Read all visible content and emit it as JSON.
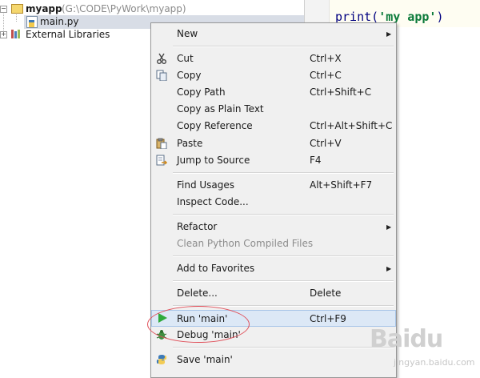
{
  "project_tree": {
    "root": {
      "name": "myapp",
      "path": "(G:\\CODE\\PyWork\\myapp)"
    },
    "file": {
      "name": "main.py"
    },
    "libraries": {
      "name": "External Libraries"
    }
  },
  "editor": {
    "code_fn": "print(",
    "code_str": "'my app'",
    "code_end": ")"
  },
  "menu": {
    "items": [
      {
        "label": "New",
        "shortcut": "",
        "submenu": true
      },
      {
        "label": "Cut",
        "shortcut": "Ctrl+X",
        "icon": "scissors-icon"
      },
      {
        "label": "Copy",
        "shortcut": "Ctrl+C",
        "icon": "copy-icon"
      },
      {
        "label": "Copy Path",
        "shortcut": "Ctrl+Shift+C"
      },
      {
        "label": "Copy as Plain Text",
        "shortcut": ""
      },
      {
        "label": "Copy Reference",
        "shortcut": "Ctrl+Alt+Shift+C"
      },
      {
        "label": "Paste",
        "shortcut": "Ctrl+V",
        "icon": "paste-icon"
      },
      {
        "label": "Jump to Source",
        "shortcut": "F4",
        "icon": "jump-to-source-icon"
      },
      {
        "label": "Find Usages",
        "shortcut": "Alt+Shift+F7"
      },
      {
        "label": "Inspect Code...",
        "shortcut": ""
      },
      {
        "label": "Refactor",
        "shortcut": "",
        "submenu": true
      },
      {
        "label": "Clean Python Compiled Files",
        "shortcut": "",
        "disabled": true
      },
      {
        "label": "Add to Favorites",
        "shortcut": "",
        "submenu": true
      },
      {
        "label": "Delete...",
        "shortcut": "Delete"
      },
      {
        "label": "Run 'main'",
        "shortcut": "Ctrl+F9",
        "icon": "run-icon",
        "highlighted": true
      },
      {
        "label": "Debug 'main'",
        "shortcut": "",
        "icon": "debug-icon"
      },
      {
        "label": "Save 'main'",
        "shortcut": "",
        "icon": "python-icon"
      }
    ]
  },
  "watermark": {
    "logo": "Baidu",
    "sub": "jingyan.baidu.com"
  },
  "colors": {
    "run_green": "#2eaa3c",
    "highlight": "#dce8f6",
    "annotation_red": "#e0505a"
  }
}
